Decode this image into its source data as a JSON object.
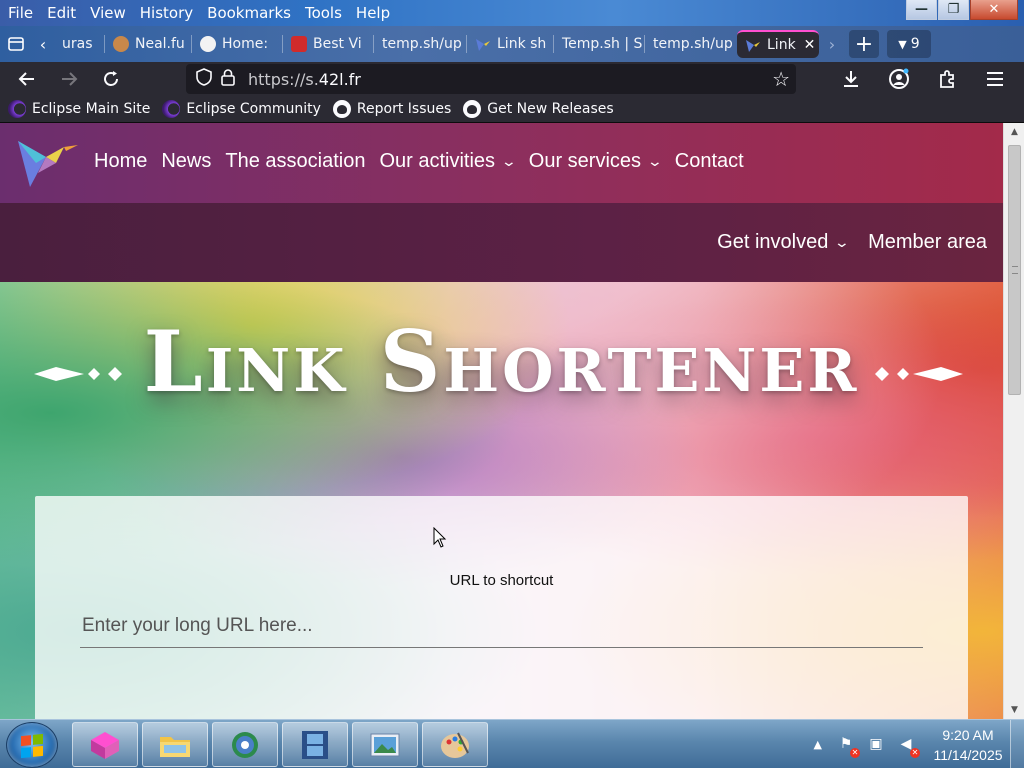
{
  "window": {
    "menu": [
      "File",
      "Edit",
      "View",
      "History",
      "Bookmarks",
      "Tools",
      "Help"
    ],
    "controls": {
      "minimize": "—",
      "maximize": "❐",
      "close": "✕"
    }
  },
  "tabs": {
    "items": [
      {
        "label": "uras",
        "favicon_color": "#8a8a8a",
        "active": false
      },
      {
        "label": "Neal.fu",
        "favicon_color": "#c8884a",
        "active": false
      },
      {
        "label": "Home:",
        "favicon_color": "#e9e9e9",
        "active": false
      },
      {
        "label": "Best Vi",
        "favicon_color": "#d12b2b",
        "active": false
      },
      {
        "label": "temp.sh/up",
        "favicon_color": "",
        "active": false
      },
      {
        "label": "Link sh",
        "favicon_color": "#7a7fd8",
        "active": false
      },
      {
        "label": "Temp.sh | S",
        "favicon_color": "",
        "active": false
      },
      {
        "label": "temp.sh/up",
        "favicon_color": "",
        "active": false
      },
      {
        "label": "Link",
        "favicon_color": "#7a7fd8",
        "active": true
      }
    ],
    "count": "9"
  },
  "navbar": {
    "url_prefix": "https://s.",
    "url_domain": "42l.fr"
  },
  "bookmarks": [
    {
      "label": "Eclipse Main Site",
      "icon": "eclipse-icon"
    },
    {
      "label": "Eclipse Community",
      "icon": "eclipse-icon"
    },
    {
      "label": "Report Issues",
      "icon": "github-icon"
    },
    {
      "label": "Get New Releases",
      "icon": "github-icon"
    }
  ],
  "site": {
    "nav": [
      {
        "label": "Home",
        "dropdown": false
      },
      {
        "label": "News",
        "dropdown": false
      },
      {
        "label": "The association",
        "dropdown": false
      },
      {
        "label": "Our activities",
        "dropdown": true
      },
      {
        "label": "Our services",
        "dropdown": true
      },
      {
        "label": "Contact",
        "dropdown": false
      }
    ],
    "nav2": [
      {
        "label": "Get involved",
        "dropdown": true
      },
      {
        "label": "Member area",
        "dropdown": false
      }
    ],
    "title": "Link Shortener",
    "form": {
      "label": "URL to shortcut",
      "placeholder": "Enter your long URL here...",
      "value": ""
    }
  },
  "taskbar": {
    "apps": [
      "app-1",
      "file-explorer",
      "browser",
      "video",
      "photos",
      "paint"
    ],
    "clock_time": "9:20 AM",
    "clock_date": "11/14/2025"
  },
  "colors": {
    "nav_gradient_start": "#6b2e6e",
    "nav_gradient_end": "#a32a4a",
    "active_tab_accent": "#ff4fd0",
    "browser_chrome": "#2b2a33"
  }
}
